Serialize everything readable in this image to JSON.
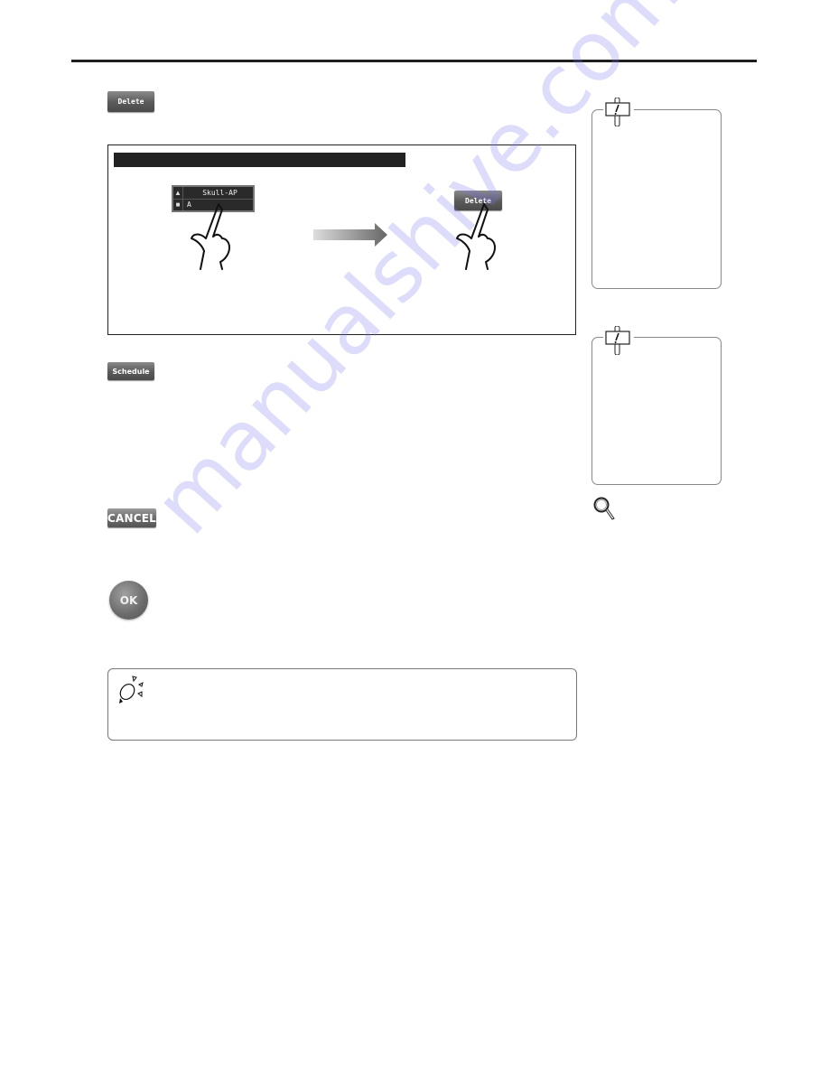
{
  "page": {
    "watermark": "manualshive.com"
  },
  "buttons": {
    "delete_label": "Delete",
    "schedule_label": "Schedule",
    "cancel_label": "CANCEL",
    "ok_label": "OK"
  },
  "example": {
    "skull_list": {
      "row1_text": "Skull-AP",
      "row2_text": "A"
    },
    "delete_label": "Delete"
  },
  "icons": {
    "caution_1": "caution-sign-icon",
    "caution_2": "caution-sign-icon",
    "reference": "magnifier-icon",
    "tip": "lightbulb-icon",
    "arrow": "right-arrow-icon",
    "hand": "pointing-hand-icon"
  },
  "colors": {
    "rule": "#1e1e1e",
    "button_gray": "#5a5a5a",
    "watermark": "#7878f0"
  }
}
